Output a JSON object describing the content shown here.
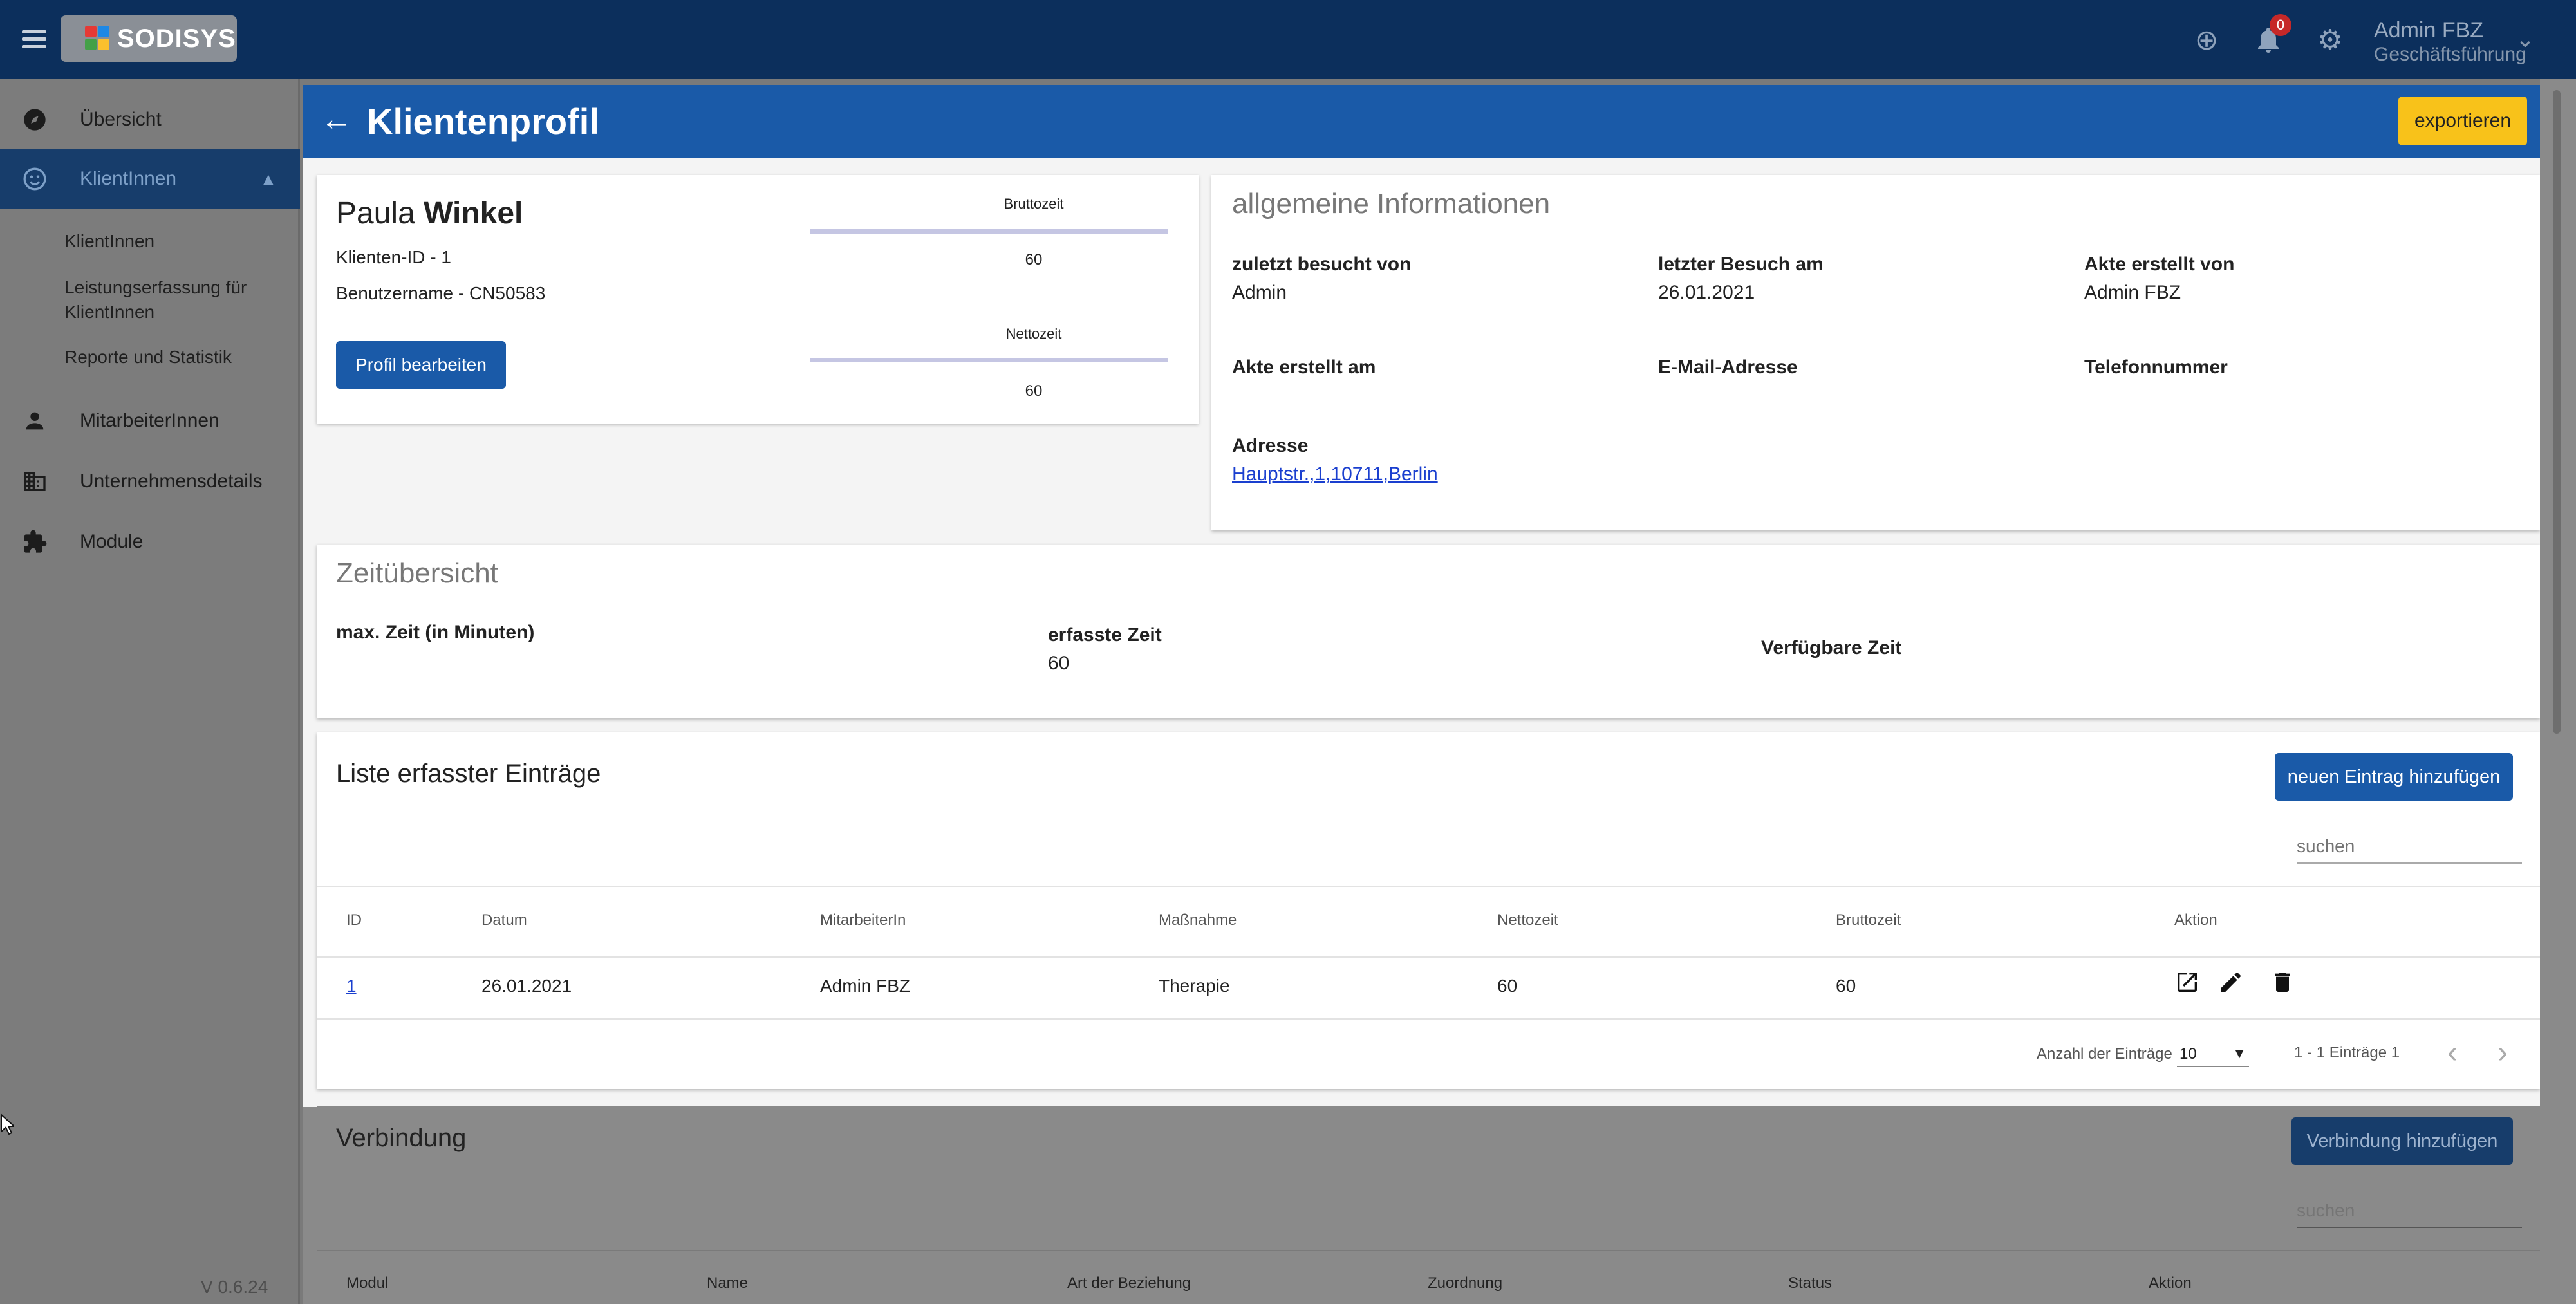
{
  "app": {
    "logo_text": "SODISYS",
    "version": "V 0.6.24"
  },
  "topbar": {
    "notification_count": "0",
    "user_name": "Admin FBZ",
    "user_role": "Geschäftsführung"
  },
  "sidebar": {
    "items": [
      {
        "label": "Übersicht",
        "icon": "compass-icon"
      },
      {
        "label": "KlientInnen",
        "icon": "smiley-icon"
      },
      {
        "label": "MitarbeiterInnen",
        "icon": "person-icon"
      },
      {
        "label": "Unternehmensdetails",
        "icon": "building-icon"
      },
      {
        "label": "Module",
        "icon": "puzzle-icon"
      }
    ],
    "sub_items": [
      "KlientInnen",
      "Leistungserfassung für KlientInnen",
      "Reporte und Statistik"
    ]
  },
  "header": {
    "title": "Klientenprofil",
    "export_label": "exportieren"
  },
  "profile": {
    "first_name": "Paula",
    "last_name": "Winkel",
    "client_id": "Klienten-ID - 1",
    "username": "Benutzername - CN50583",
    "edit_label": "Profil bearbeiten",
    "brutto_label": "Bruttozeit",
    "brutto_value": "60",
    "netto_label": "Nettozeit",
    "netto_value": "60"
  },
  "info": {
    "title": "allgemeine Informationen",
    "fields": [
      {
        "label": "zuletzt besucht von",
        "value": "Admin"
      },
      {
        "label": "letzter Besuch am",
        "value": "26.01.2021"
      },
      {
        "label": "Akte erstellt von",
        "value": "Admin FBZ"
      },
      {
        "label": "Akte erstellt am",
        "value": ""
      },
      {
        "label": "E-Mail-Adresse",
        "value": ""
      },
      {
        "label": "Telefonnummer",
        "value": ""
      }
    ],
    "address_label": "Adresse",
    "address_value": "Hauptstr.,1,10711,Berlin"
  },
  "time": {
    "title": "Zeitübersicht",
    "max_label": "max. Zeit (in Minuten)",
    "recorded_label": "erfasste Zeit",
    "recorded_value": "60",
    "available_label": "Verfügbare Zeit"
  },
  "entries": {
    "title": "Liste erfasster Einträge",
    "add_label": "neuen Eintrag hinzufügen",
    "search_placeholder": "suchen",
    "columns": [
      "ID",
      "Datum",
      "MitarbeiterIn",
      "Maßnahme",
      "Nettozeit",
      "Bruttozeit",
      "Aktion"
    ],
    "rows": [
      {
        "id": "1",
        "date": "26.01.2021",
        "staff": "Admin FBZ",
        "measure": "Therapie",
        "netto": "60",
        "brutto": "60"
      }
    ],
    "page_size_label": "Anzahl der Einträge",
    "page_size": "10",
    "range": "1 - 1 Einträge 1"
  },
  "connections": {
    "title": "Verbindung",
    "add_label": "Verbindung hinzufügen",
    "search_placeholder": "suchen",
    "columns": [
      "Modul",
      "Name",
      "Art der Beziehung",
      "Zuordnung",
      "Status",
      "Aktion"
    ]
  }
}
